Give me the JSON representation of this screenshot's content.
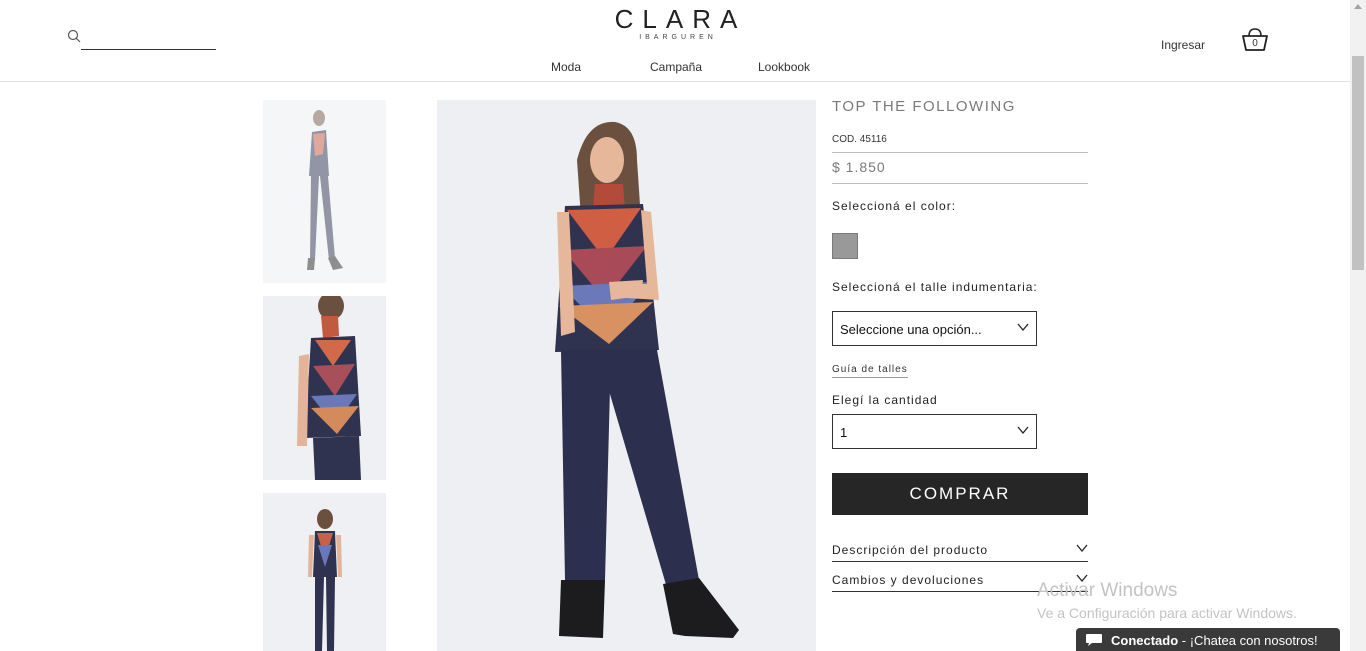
{
  "header": {
    "logo_main": "CLARA",
    "logo_sub": "IBARGUREN",
    "search_placeholder": "",
    "nav": [
      "Moda",
      "Campaña",
      "Lookbook"
    ],
    "login": "Ingresar",
    "cart_count": "0"
  },
  "product": {
    "title": "TOP THE FOLLOWING",
    "code": "COD. 45116",
    "price": "$ 1.850",
    "color_label": "Seleccioná el color:",
    "swatch_color": "#999999",
    "size_label": "Seleccioná el talle indumentaria:",
    "size_select": "Seleccione una opción...",
    "size_guide": "Guía de talles",
    "qty_label": "Elegí la cantidad",
    "qty_value": "1",
    "buy_label": "COMPRAR",
    "accordions": [
      "Descripción del producto",
      "Cambios y devoluciones"
    ]
  },
  "watermark": {
    "line1": "Activar Windows",
    "line2": "Ve a Configuración para activar Windows."
  },
  "chat": {
    "status": "Conectado",
    "message": " - ¡Chatea con nosotros!"
  }
}
